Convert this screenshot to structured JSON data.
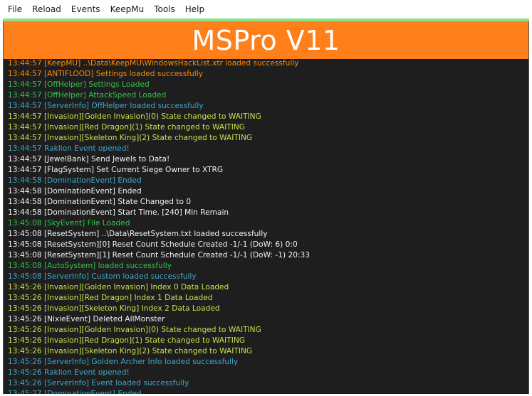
{
  "menu": [
    "File",
    "Reload",
    "Events",
    "KeepMu",
    "Tools",
    "Help"
  ],
  "banner": {
    "title": "MSPro V11"
  },
  "colors": {
    "banner": "#ff7f1a",
    "log_background": "#1e1e1e",
    "orange": "#ff8a00",
    "green": "#33c24d",
    "lime": "#c8e24a",
    "cyan": "#3fa7c9",
    "white": "#f2f2f2"
  },
  "log": [
    {
      "text": "13:44:57 [KeepMU] ..\\Data\\KeepMU\\WindowsHackList.xtr loaded successfully",
      "color": "orange"
    },
    {
      "text": "13:44:57 [ANTIFLOOD] Settings loaded successfully",
      "color": "orange"
    },
    {
      "text": "13:44:57 [OffHelper] Settings Loaded",
      "color": "green"
    },
    {
      "text": "13:44:57 [OffHelper] AttackSpeed Loaded",
      "color": "green"
    },
    {
      "text": "13:44:57 [ServerInfo] OffHelper loaded successfully",
      "color": "cyan"
    },
    {
      "text": "13:44:57 [Invasion][Golden Invasion](0) State changed to WAITING",
      "color": "lime"
    },
    {
      "text": "13:44:57 [Invasion][Red Dragon](1) State changed to WAITING",
      "color": "lime"
    },
    {
      "text": "13:44:57 [Invasion][Skeleton King](2) State changed to WAITING",
      "color": "lime"
    },
    {
      "text": "13:44:57 Raklion Event opened!",
      "color": "cyan"
    },
    {
      "text": "13:44:57 [JewelBank] Send Jewels to Data!",
      "color": "white"
    },
    {
      "text": "13:44:57 [FlagSystem] Set Current Siege Owner to XTRG",
      "color": "white"
    },
    {
      "text": "13:44:58 [DominationEvent] Ended",
      "color": "cyan"
    },
    {
      "text": "13:44:58 [DominationEvent] Ended",
      "color": "white"
    },
    {
      "text": "13:44:58 [DominationEvent] State Changed to 0",
      "color": "white"
    },
    {
      "text": "13:44:58 [DominationEvent] Start Time. [240] Min Remain",
      "color": "white"
    },
    {
      "text": "13:45:08 [SkyEvent] File Loaded",
      "color": "green"
    },
    {
      "text": "13:45:08 [ResetSystem] ..\\Data\\ResetSystem.txt loaded successfully",
      "color": "white"
    },
    {
      "text": "13:45:08 [ResetSystem][0] Reset Count Schedule Created -1/-1 (DoW: 6) 0:0",
      "color": "white"
    },
    {
      "text": "13:45:08 [ResetSystem][1] Reset Count Schedule Created -1/-1 (DoW: -1) 20:33",
      "color": "white"
    },
    {
      "text": "13:45:08 [AutoSystem] loaded successfully",
      "color": "green"
    },
    {
      "text": "13:45:08 [ServerInfo] Custom loaded successfully",
      "color": "cyan"
    },
    {
      "text": "13:45:26 [Invasion][Golden Invasion] Index 0 Data Loaded",
      "color": "lime"
    },
    {
      "text": "13:45:26 [Invasion][Red Dragon] Index 1 Data Loaded",
      "color": "lime"
    },
    {
      "text": "13:45:26 [Invasion][Skeleton King] Index 2 Data Loaded",
      "color": "lime"
    },
    {
      "text": "13:45:26 [NixieEvent] Deleted AllMonster",
      "color": "white"
    },
    {
      "text": "13:45:26 [Invasion][Golden Invasion](0) State changed to WAITING",
      "color": "lime"
    },
    {
      "text": "13:45:26 [Invasion][Red Dragon](1) State changed to WAITING",
      "color": "lime"
    },
    {
      "text": "13:45:26 [Invasion][Skeleton King](2) State changed to WAITING",
      "color": "lime"
    },
    {
      "text": "13:45:26 [ServerInfo] Golden Archer Info loaded successfully",
      "color": "cyan"
    },
    {
      "text": "13:45:26 Raklion Event opened!",
      "color": "cyan"
    },
    {
      "text": "13:45:26 [ServerInfo] Event loaded successfully",
      "color": "cyan"
    },
    {
      "text": "13:45:27 [DominationEvent] Ended",
      "color": "cyan"
    }
  ]
}
